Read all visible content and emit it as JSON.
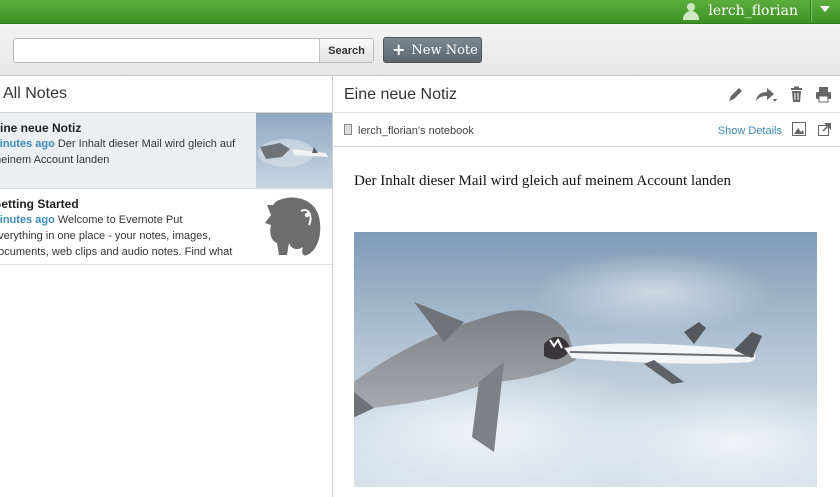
{
  "header": {
    "username": "lerch_florian"
  },
  "toolbar": {
    "search_placeholder": "",
    "search_label": "Search",
    "new_note_label": "New Note"
  },
  "notes_list": {
    "title": "All Notes",
    "items": [
      {
        "title": "Eine neue Notiz",
        "time": "minutes ago",
        "snippet_1": "Der Inhalt dieser Mail wird gleich auf",
        "snippet_2": "meinem Account landen",
        "selected": true
      },
      {
        "title": "Getting Started",
        "time": "minutes ago",
        "snippet_1": "Welcome to Evernote Put",
        "snippet_2": "everything in one place - your notes, images,",
        "snippet_3": "documents, web clips and audio notes. Find what"
      }
    ]
  },
  "note": {
    "title": "Eine neue Notiz",
    "notebook": "lerch_florian's notebook",
    "show_details": "Show Details",
    "body": "Der Inhalt dieser Mail wird gleich auf meinem Account landen"
  },
  "colors": {
    "brand_green": "#4da032",
    "link_blue": "#3d8ab7",
    "button_gray": "#6a737b"
  },
  "icons": [
    "user-icon",
    "chevron-down-icon",
    "plus-icon",
    "pencil-icon",
    "share-icon",
    "trash-icon",
    "print-icon",
    "notebook-icon",
    "image-icon",
    "expand-icon",
    "elephant-icon"
  ]
}
